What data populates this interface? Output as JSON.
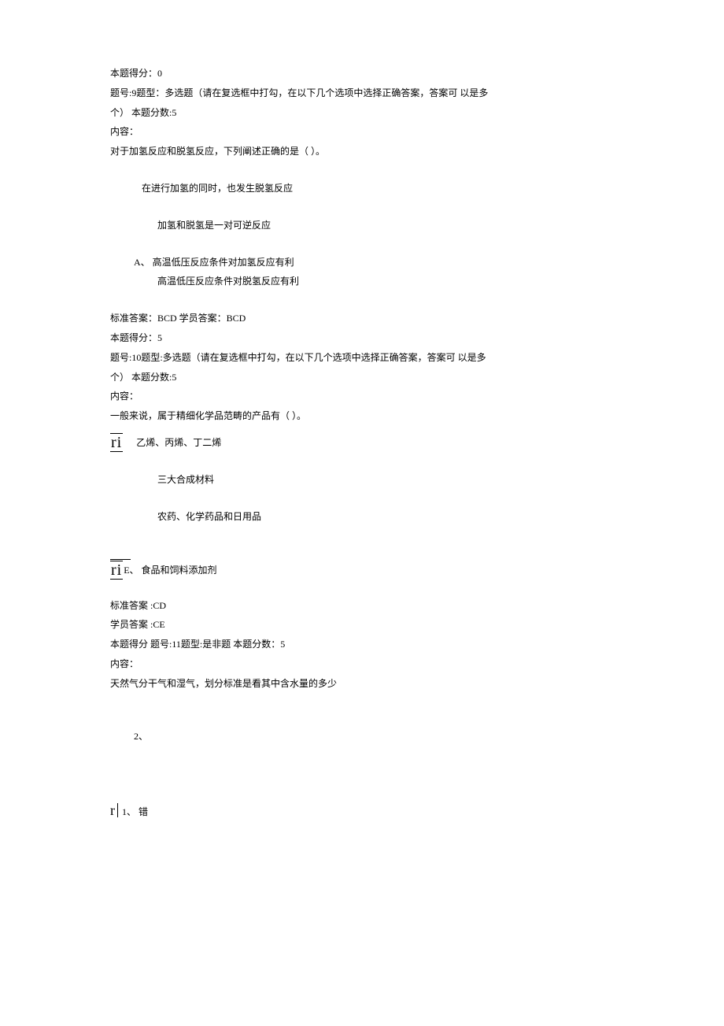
{
  "q8": {
    "score_line": "本题得分：0"
  },
  "q9": {
    "header": "题号:9题型：多选题（请在复选框中打勾，在以下几个选项中选择正确答案，答案可 以是多",
    "header2": "个）          本题分数:5",
    "content_label": "内容：",
    "stem": "对于加氢反应和脱氢反应，下列阐述正确的是（            ）。",
    "opt_b": "在进行加氢的同时，也发生脱氢反应",
    "opt_c": "加氢和脱氢是一对可逆反应",
    "opt_a": "A、 高温低压反应条件对加氢反应有利",
    "opt_d": "高温低压反应条件对脱氢反应有利",
    "answer": "标准答案：BCD 学员答案：BCD",
    "score": "本题得分：5"
  },
  "q10": {
    "header": "题号:10题型:多选题（请在复选框中打勾，在以下几个选项中选择正确答案，答案可 以是多",
    "header2": "个）         本题分数:5",
    "content_label": "内容：",
    "stem": "一般来说，属于精细化学品范畴的产品有（         ）。",
    "ri1": "ri",
    "opt_a": "乙烯、丙烯、丁二烯",
    "opt_b": "三大合成材料",
    "opt_c": "农药、化学药品和日用品",
    "ri2": "ri",
    "opt_e_label": "E、  食品和饲料添加剂",
    "std_answer": "标准答案   :CD",
    "stu_answer": "学员答案   :CE"
  },
  "q11": {
    "header": "本题得分  题号:11题型:是非题  本题分数：5",
    "content_label": "内容：",
    "stem": "天然气分干气和湿气，划分标准是看其中含水量的多少",
    "opt_2": "2、",
    "r_sym": "r",
    "opt_1": "1、  错"
  }
}
